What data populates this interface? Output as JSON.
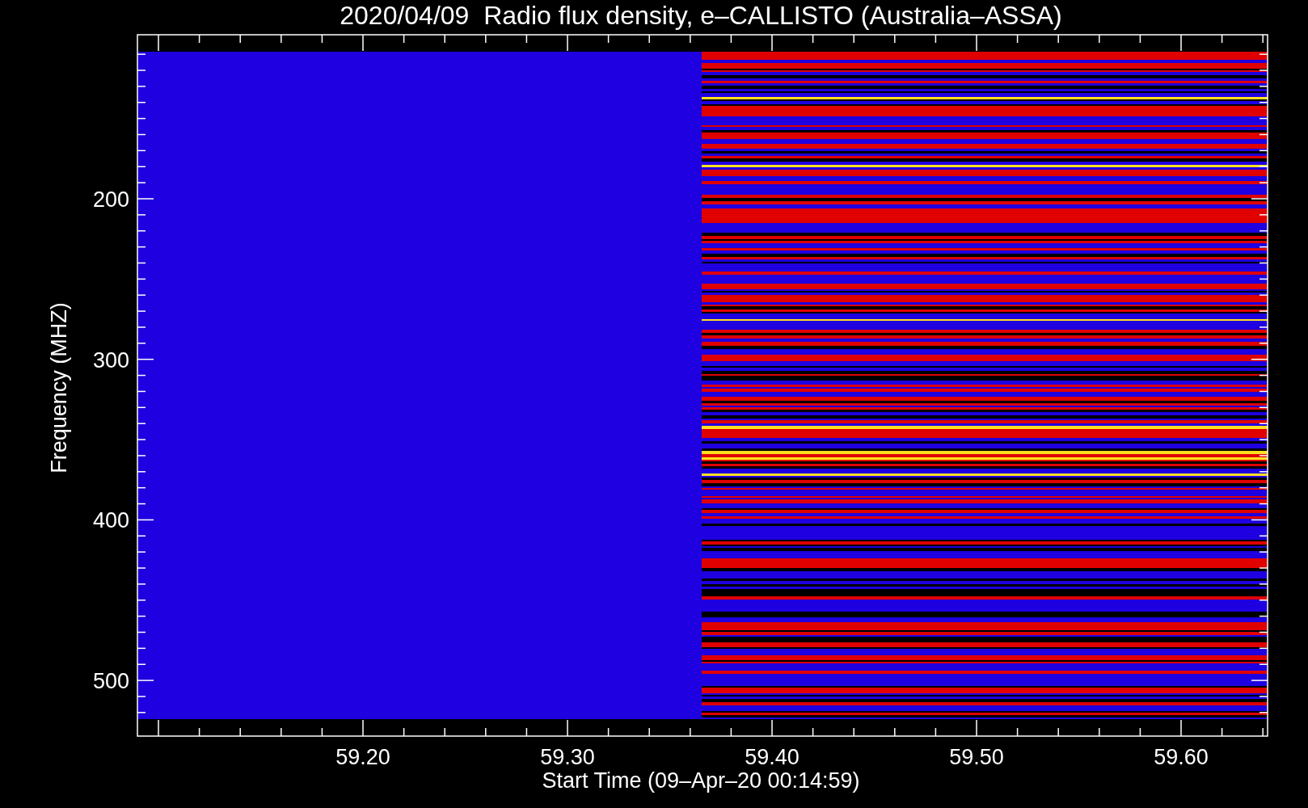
{
  "title": "2020/04/09  Radio flux density, e–CALLISTO (Australia–ASSA)",
  "y_axis": {
    "label": "Frequency (MHZ)",
    "ticks": [
      "200",
      "300",
      "400",
      "500"
    ]
  },
  "x_axis": {
    "label": "Start Time (09–Apr–20 00:14:59)",
    "ticks": [
      "59.20",
      "59.30",
      "59.40",
      "59.50",
      "59.60"
    ]
  }
}
